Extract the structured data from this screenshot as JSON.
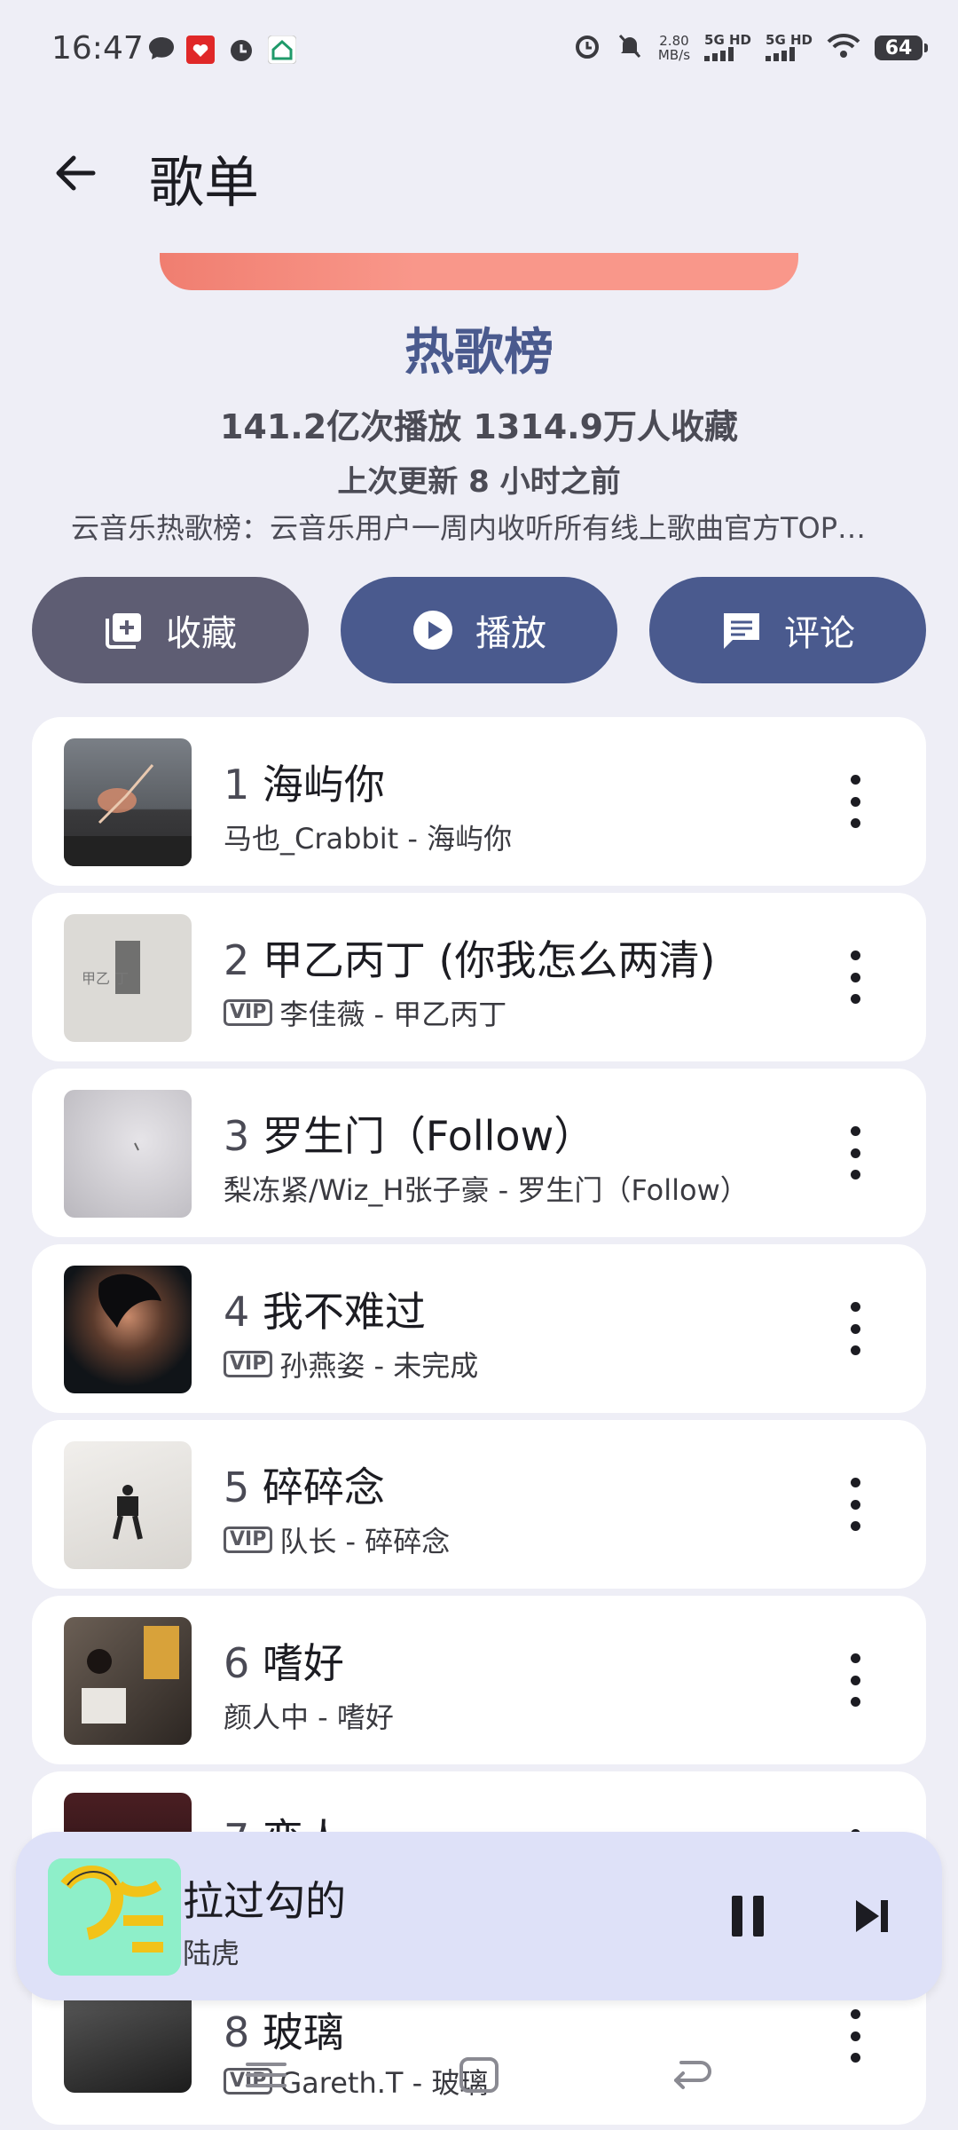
{
  "status_bar": {
    "time": "16:47",
    "speed_value": "2.80",
    "speed_unit": "MB/s",
    "signal1": "5G HD",
    "signal2": "5G HD",
    "battery": "64"
  },
  "app_bar": {
    "title": "歌单"
  },
  "playlist": {
    "title": "热歌榜",
    "stats": "141.2亿次播放  1314.9万人收藏",
    "updated": "上次更新 8 小时之前",
    "description": "云音乐热歌榜：云音乐用户一周内收听所有线上歌曲官方TOP排行榜，每日更新。",
    "cover_colors": [
      "#F07E70",
      "#F9978A"
    ]
  },
  "actions": {
    "collect": "收藏",
    "play": "播放",
    "comment": "评论"
  },
  "songs": [
    {
      "num": "1",
      "title": "海屿你",
      "vip": "",
      "subtitle": "马也_Crabbit - 海屿你"
    },
    {
      "num": "2",
      "title": "甲乙丙丁 (你我怎么两清)",
      "vip": "VIP",
      "subtitle": "李佳薇 - 甲乙丙丁"
    },
    {
      "num": "3",
      "title": "罗生门（Follow）",
      "vip": "",
      "subtitle": "梨冻紧/Wiz_H张子豪 - 罗生门（Follow）"
    },
    {
      "num": "4",
      "title": "我不难过",
      "vip": "VIP",
      "subtitle": "孙燕姿 - 未完成"
    },
    {
      "num": "5",
      "title": "碎碎念",
      "vip": "VIP",
      "subtitle": "队长 - 碎碎念"
    },
    {
      "num": "6",
      "title": "嗜好",
      "vip": "",
      "subtitle": "颜人中 - 嗜好"
    },
    {
      "num": "7",
      "title": "恋人",
      "vip": "",
      "subtitle": ""
    },
    {
      "num": "8",
      "title": "玻璃",
      "vip": "VIP",
      "subtitle": "Gareth.T - 玻璃"
    }
  ],
  "now_playing": {
    "title": "拉过勾的",
    "artist": "陆虎"
  },
  "colors": {
    "background": "#EEEEF6",
    "accent": "#4A5A8E",
    "collect_button": "#5E5D73",
    "player_bg": "#DEE1F8"
  }
}
